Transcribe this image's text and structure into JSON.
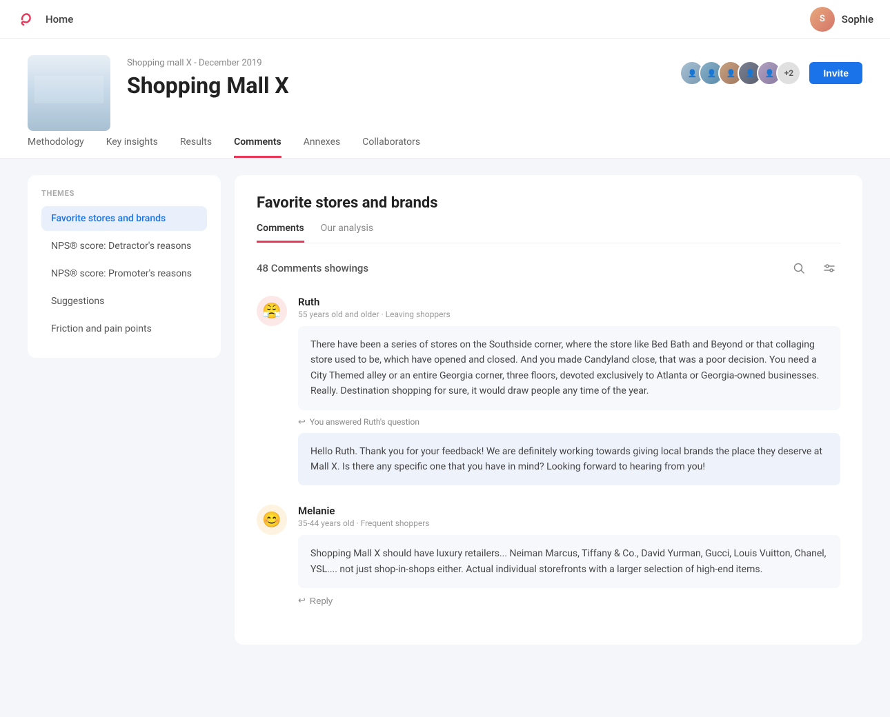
{
  "topnav": {
    "home_label": "Home",
    "user_name": "Sophie",
    "user_initials": "S"
  },
  "project": {
    "subtitle": "Shopping mall X - December 2019",
    "title": "Shopping Mall X",
    "nav_items": [
      {
        "id": "methodology",
        "label": "Methodology",
        "active": false
      },
      {
        "id": "key-insights",
        "label": "Key insights",
        "active": false
      },
      {
        "id": "results",
        "label": "Results",
        "active": false
      },
      {
        "id": "comments",
        "label": "Comments",
        "active": true
      },
      {
        "id": "annexes",
        "label": "Annexes",
        "active": false
      },
      {
        "id": "collaborators",
        "label": "Collaborators",
        "active": false
      }
    ],
    "avatars_extra": "+2",
    "invite_label": "Invite"
  },
  "sidebar": {
    "themes_label": "THEMES",
    "items": [
      {
        "id": "favorite-stores",
        "label": "Favorite stores and brands",
        "active": true
      },
      {
        "id": "nps-detractor",
        "label": "NPS® score: Detractor's reasons",
        "active": false
      },
      {
        "id": "nps-promoter",
        "label": "NPS® score: Promoter's reasons",
        "active": false
      },
      {
        "id": "suggestions",
        "label": "Suggestions",
        "active": false
      },
      {
        "id": "friction",
        "label": "Friction and pain points",
        "active": false
      }
    ]
  },
  "content": {
    "title": "Favorite stores and brands",
    "tabs": [
      {
        "id": "comments",
        "label": "Comments",
        "active": true
      },
      {
        "id": "analysis",
        "label": "Our analysis",
        "active": false
      }
    ],
    "comments_count": "48 Comments showings",
    "comments": [
      {
        "id": "ruth",
        "avatar_emoji": "😤",
        "author": "Ruth",
        "meta": "55 years old and older · Leaving shoppers",
        "text": "There have been a series of stores on the Southside corner, where the store like Bed Bath and Beyond or that collaging store used to be, which have opened and closed. And you made Candyland close, that was a poor decision. You need a City Themed alley or an entire Georgia corner, three floors, devoted exclusively to Atlanta or Georgia-owned businesses. Really. Destination shopping for sure, it would draw people any time of the year.",
        "has_reply": true,
        "reply_indicator": "You answered Ruth's question",
        "reply_text": "Hello Ruth. Thank you for your feedback! We are definitely working towards giving local brands the place they deserve at Mall X. Is there any specific one that you have in mind? Looking forward to hearing from you!",
        "reply_btn_label": null
      },
      {
        "id": "melanie",
        "avatar_emoji": "😊",
        "author": "Melanie",
        "meta": "35-44 years old · Frequent shoppers",
        "text": "Shopping Mall X should have luxury retailers... Neiman Marcus, Tiffany & Co., David Yurman, Gucci, Louis Vuitton, Chanel, YSL.... not just shop-in-shops either. Actual individual storefronts with a larger selection of high-end items.",
        "has_reply": false,
        "reply_indicator": null,
        "reply_text": null,
        "reply_btn_label": "Reply"
      }
    ]
  }
}
